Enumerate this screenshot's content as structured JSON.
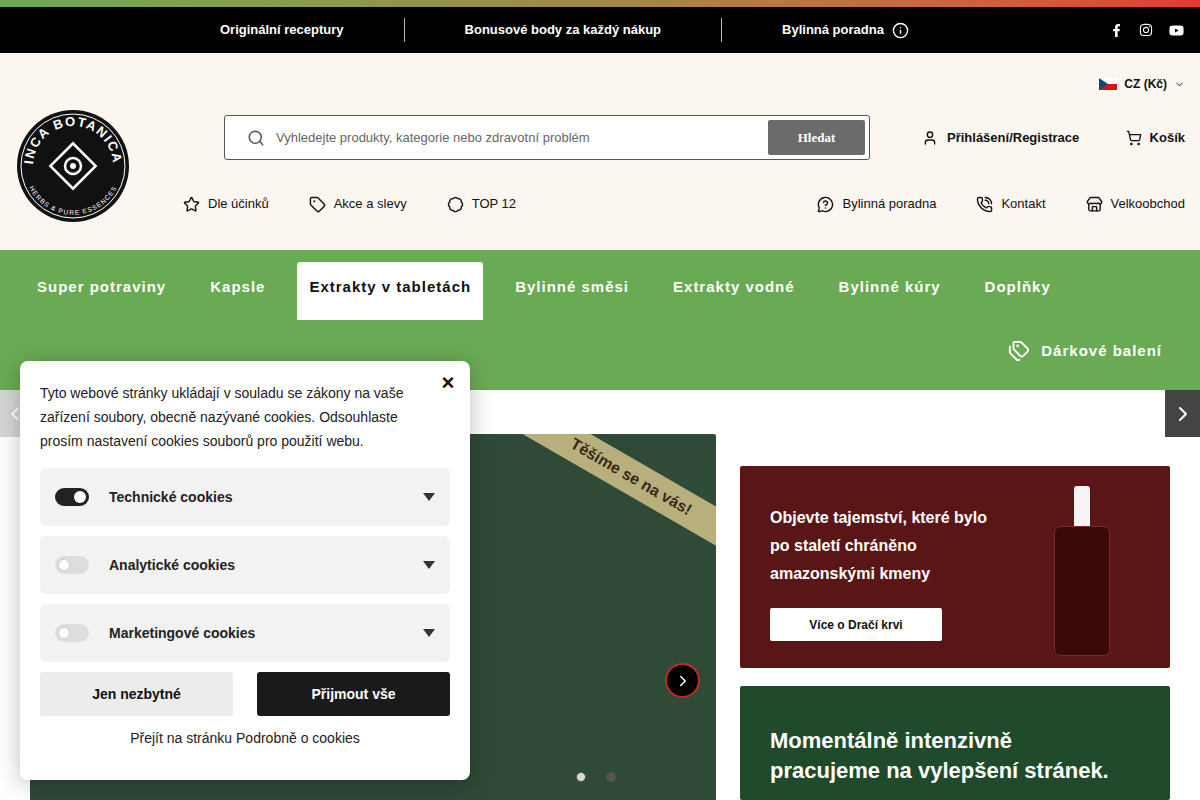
{
  "topbar": {
    "items": [
      "Originální receptury",
      "Bonusové body za každý nákup",
      "Bylinná poradna"
    ]
  },
  "currency": "CZ (Kč)",
  "logo": {
    "title": "INCA BOTANICA",
    "subtitle": "HERBS & PURE ESSENCES"
  },
  "search": {
    "placeholder": "Vyhledejte produkty, kategorie nebo zdravotní problém",
    "button": "Hledat"
  },
  "account": "Přihlášení/Registrace",
  "cart": "Košík",
  "quick_links": [
    "Dle účinků",
    "Akce a slevy",
    "TOP 12"
  ],
  "service_links": [
    "Bylinná poradna",
    "Kontakt",
    "Velkoobchod"
  ],
  "categories": [
    {
      "label": "Super potraviny",
      "selected": false
    },
    {
      "label": "Kapsle",
      "selected": false
    },
    {
      "label": "Extrakty v tabletách",
      "selected": true
    },
    {
      "label": "Bylinné směsi",
      "selected": false
    },
    {
      "label": "Extrakty vodné",
      "selected": false
    },
    {
      "label": "Bylinné kúry",
      "selected": false
    },
    {
      "label": "Doplňky",
      "selected": false
    }
  ],
  "gift": "Dárkové balení",
  "hero": {
    "ribbon": "Těšíme se na vás!",
    "dots": [
      {
        "selected": false
      },
      {
        "selected": true
      }
    ]
  },
  "promos": [
    {
      "lines": [
        "Objevte tajemství, které bylo",
        "po staletí chráněno",
        "amazonskými kmeny"
      ],
      "button": "Více o Dračí krvi"
    },
    {
      "lines": [
        "Momentálně intenzivně",
        "pracujeme na vylepšení stránek."
      ]
    }
  ],
  "cookies": {
    "close": "×",
    "text": "Tyto webové stránky ukládají v souladu se zákony na vaše zařízení soubory, obecně nazývané cookies. Odsouhlaste prosím nastavení cookies souborů pro použití webu.",
    "options": [
      {
        "label": "Technické cookies",
        "on": true
      },
      {
        "label": "Analytické cookies",
        "on": false
      },
      {
        "label": "Marketingové cookies",
        "on": false
      }
    ],
    "buttons": [
      "Jen nezbytné",
      "Přijmout vše"
    ],
    "link": "Přejít na stránku Podrobně o cookies"
  }
}
